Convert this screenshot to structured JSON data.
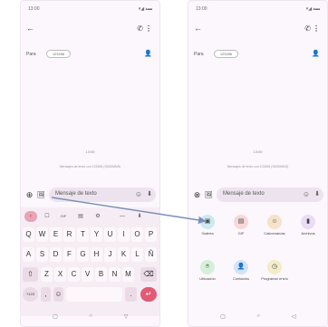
{
  "left_phone": {
    "status_time": "13:00",
    "status_icons": "▾◢ ▴▬",
    "back_icon": "←",
    "call_icon": "✆",
    "more_icon": "⋮",
    "to_label": "Para",
    "recipient_chip": "123456",
    "add_contact_icon": "👤",
    "timestamp": "13:00",
    "info_line": "Mensajes de texto con 123456 (SMS/MMS)",
    "compose_plus_icon": "⊕",
    "compose_gallery_icon": "🖼",
    "compose_placeholder": "Mensaje de texto",
    "emoji_icon": "☺",
    "mic_icon": "⬇",
    "keyboard": {
      "toolbar": [
        "‹",
        "☐",
        "GIF",
        "▤",
        "⚙",
        "—",
        "⬇"
      ],
      "row1": [
        "Q",
        "W",
        "E",
        "R",
        "T",
        "Y",
        "U",
        "I",
        "O",
        "P"
      ],
      "row1_hints": [
        "1",
        "2",
        "3",
        "4",
        "5",
        "6",
        "7",
        "8",
        "9",
        "0"
      ],
      "row2": [
        "A",
        "S",
        "D",
        "F",
        "G",
        "H",
        "J",
        "K",
        "L",
        "Ñ"
      ],
      "row3": [
        "Z",
        "X",
        "C",
        "V",
        "B",
        "N",
        "M"
      ],
      "shift": "⇧",
      "backspace": "⌫",
      "symbols_key": "?123",
      "comma_key": ",",
      "emoji_key": "☺",
      "space_key": "",
      "period_key": ".",
      "enter_key": "↵"
    },
    "nav": {
      "home": "▢",
      "home2": "○",
      "back": "▽"
    }
  },
  "right_phone": {
    "status_time": "13:00",
    "status_icons": "▾◢ ▴▬",
    "back_icon": "←",
    "call_icon": "✆",
    "more_icon": "⋮",
    "to_label": "Para",
    "recipient_chip": "123456",
    "add_contact_icon": "👤",
    "timestamp": "13:00",
    "info_line": "Mensajes de texto con 123456 (SMS/MMS)",
    "compose_plus_icon": "⊗",
    "compose_gallery_icon": "🖼",
    "compose_placeholder": "Mensaje de texto",
    "emoji_icon": "☺",
    "mic_icon": "⬇",
    "attachments": [
      {
        "label": "Galería",
        "icon": "▣",
        "color": "#cde9f2"
      },
      {
        "label": "GIF",
        "icon": "▤",
        "color": "#f7d7d9"
      },
      {
        "label": "Calcomanías",
        "icon": "☺",
        "color": "#f5e3c9"
      },
      {
        "label": "Archivos",
        "icon": "▮",
        "color": "#e8dcf6"
      },
      {
        "label": "Ubicación",
        "icon": "⌾",
        "color": "#d5efd9"
      },
      {
        "label": "Contactos",
        "icon": "👤",
        "color": "#d3e3f6"
      },
      {
        "label": "Programar envío",
        "icon": "◷",
        "color": "#f4ecc8"
      }
    ],
    "nav": {
      "home": "▢",
      "home2": "○",
      "back": "◁"
    }
  }
}
